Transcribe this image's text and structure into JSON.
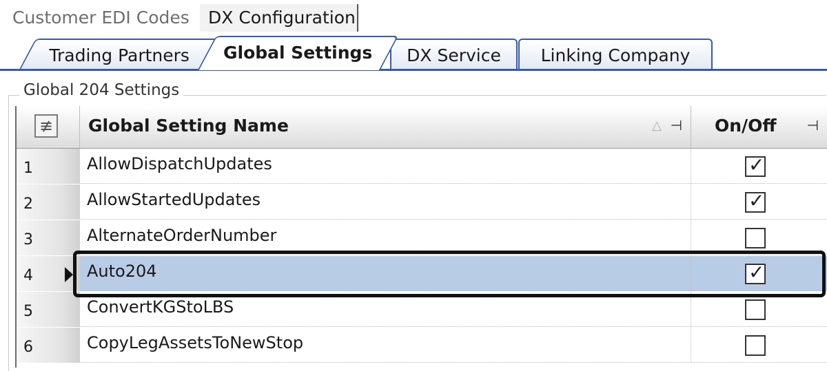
{
  "top_tabs": [
    "Customer EDI Codes",
    "DX Configuration"
  ],
  "tabs": [
    "Trading Partners",
    "Global Settings",
    "DX Service",
    "Linking Company"
  ],
  "group_title": "Global 204 Settings",
  "grid": {
    "col_name": "Global Setting Name",
    "col_onoff": "On/Off",
    "rows": [
      {
        "num": "1",
        "name": "AllowDispatchUpdates",
        "checked": true
      },
      {
        "num": "2",
        "name": "AllowStartedUpdates",
        "checked": true
      },
      {
        "num": "3",
        "name": "AlternateOrderNumber",
        "checked": false
      },
      {
        "num": "4",
        "name": "Auto204",
        "checked": true
      },
      {
        "num": "5",
        "name": "ConvertKGStoLBS",
        "checked": false
      },
      {
        "num": "6",
        "name": "CopyLegAssetsToNewStop",
        "checked": false
      }
    ],
    "selected_row_index": 3
  },
  "icons": {
    "chooser": "column-chooser-icon",
    "sort": "sort-ascending-icon",
    "pin": "pin-icon",
    "check": "check-icon",
    "row_indicator": "row-arrow-icon"
  },
  "colors": {
    "tab_border": "#3658b4",
    "selected_row": "#b9cce6",
    "highlight": "#111111"
  }
}
